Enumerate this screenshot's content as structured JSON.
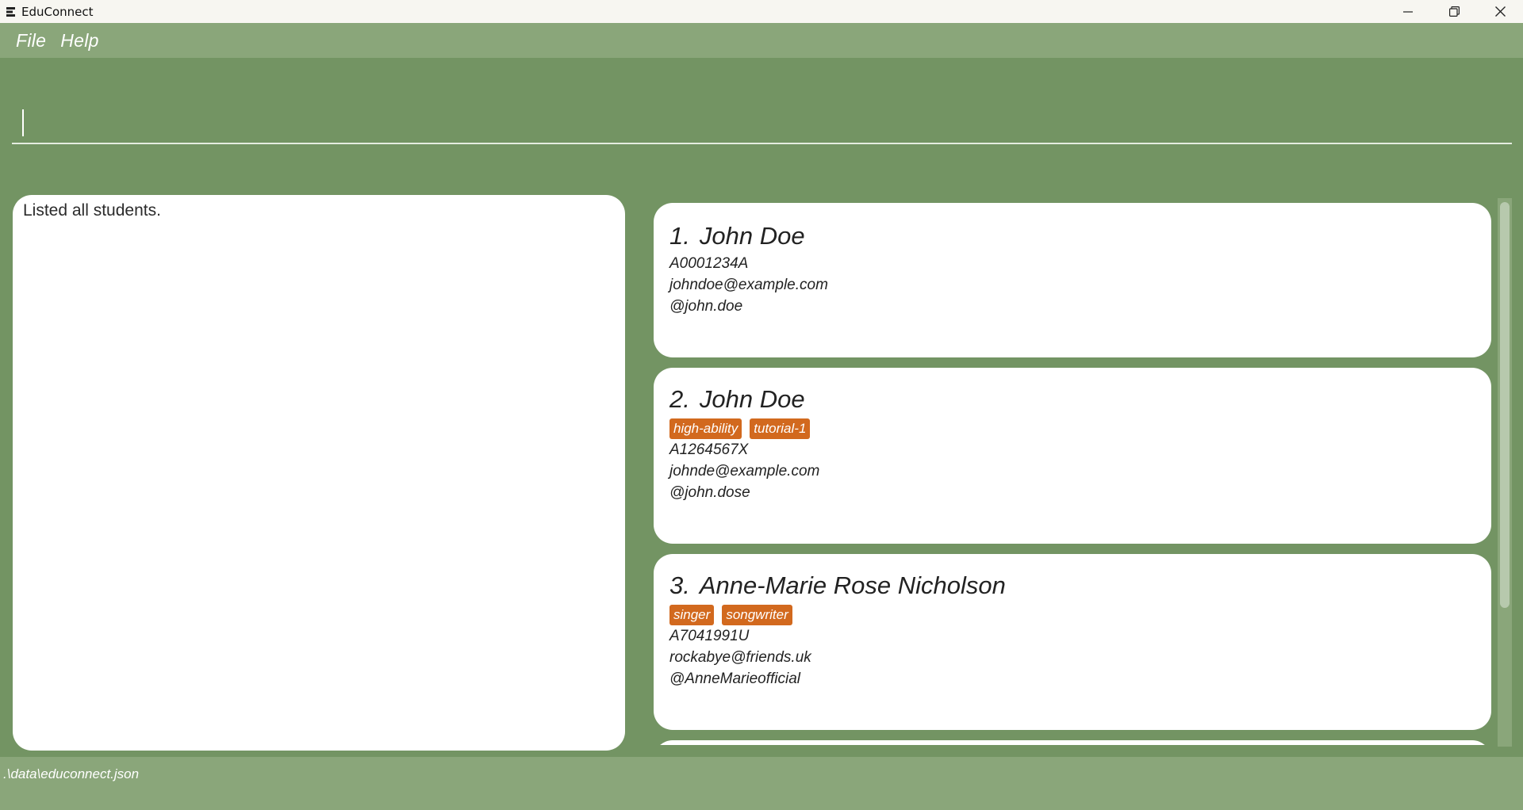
{
  "window": {
    "title": "EduConnect",
    "controls": [
      "minimize-icon",
      "restore-icon",
      "close-icon"
    ]
  },
  "menu": {
    "items": [
      {
        "label": "File"
      },
      {
        "label": "Help"
      }
    ]
  },
  "command": {
    "value": "",
    "placeholder": ""
  },
  "result": {
    "text": "Listed all students."
  },
  "students": [
    {
      "index": "1.",
      "name": "John Doe",
      "tags": [],
      "student_id": "A0001234A",
      "email": "johndoe@example.com",
      "telegram": "@john.doe"
    },
    {
      "index": "2.",
      "name": "John Doe",
      "tags": [
        "high-ability",
        "tutorial-1"
      ],
      "student_id": "A1264567X",
      "email": "johnde@example.com",
      "telegram": "@john.dose"
    },
    {
      "index": "3.",
      "name": "Anne-Marie Rose Nicholson",
      "tags": [
        "singer",
        "songwriter"
      ],
      "student_id": "A7041991U",
      "email": "rockabye@friends.uk",
      "telegram": "@AnneMarieofficial"
    }
  ],
  "status": {
    "path": ".\\data\\educonnect.json"
  },
  "colors": {
    "background": "#739463",
    "menubar": "#8aa67a",
    "tag": "#d2691e",
    "card": "#ffffff"
  }
}
